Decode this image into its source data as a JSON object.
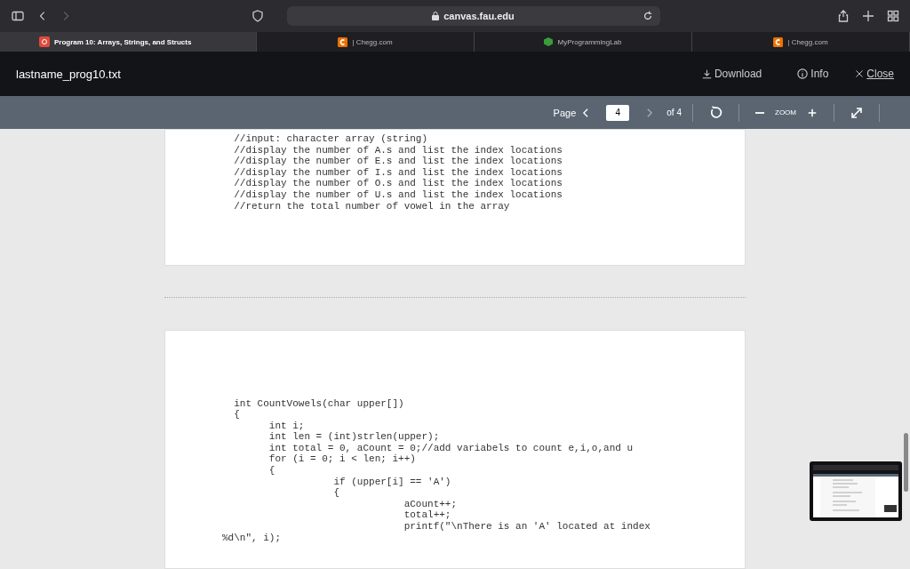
{
  "browser": {
    "address": "canvas.fau.edu"
  },
  "tabs": [
    {
      "label": "Program 10: Arrays, Strings, and Structs",
      "selected": true,
      "kind": "canvas"
    },
    {
      "label": "| Chegg.com",
      "selected": false,
      "kind": "chegg"
    },
    {
      "label": "MyProgrammingLab",
      "selected": false,
      "kind": "mpl"
    },
    {
      "label": "| Chegg.com",
      "selected": false,
      "kind": "chegg"
    }
  ],
  "viewer": {
    "file_name": "lastname_prog10.txt",
    "actions": [
      {
        "label": "Download",
        "kind": "download"
      },
      {
        "label": "Info",
        "kind": "info"
      },
      {
        "label": "Close",
        "kind": "close"
      }
    ]
  },
  "toolbar": {
    "page_label": "Page",
    "page_value": "4",
    "page_total": "of 4",
    "zoom_label": "ZOOM"
  },
  "pages": [
    {
      "lines": [
        "  //input: character array (string)",
        "  //display the number of A.s and list the index locations",
        "  //display the number of E.s and list the index locations",
        "  //display the number of I.s and list the index locations",
        "  //display the number of O.s and list the index locations",
        "  //display the number of U.s and list the index locations",
        "  //return the total number of vowel in the array"
      ]
    },
    {
      "lines": [
        "  int CountVowels(char upper[])",
        "  {",
        "        int i;",
        "        int len = (int)strlen(upper);",
        "        int total = 0, aCount = 0;//add variabels to count e,i,o,and u",
        "        for (i = 0; i < len; i++)",
        "        {",
        "                   if (upper[i] == 'A')",
        "                   {",
        "                               aCount++;",
        "                               total++;",
        "                               printf(\"\\nThere is an 'A' located at index",
        "%d\\n\", i);"
      ]
    }
  ]
}
